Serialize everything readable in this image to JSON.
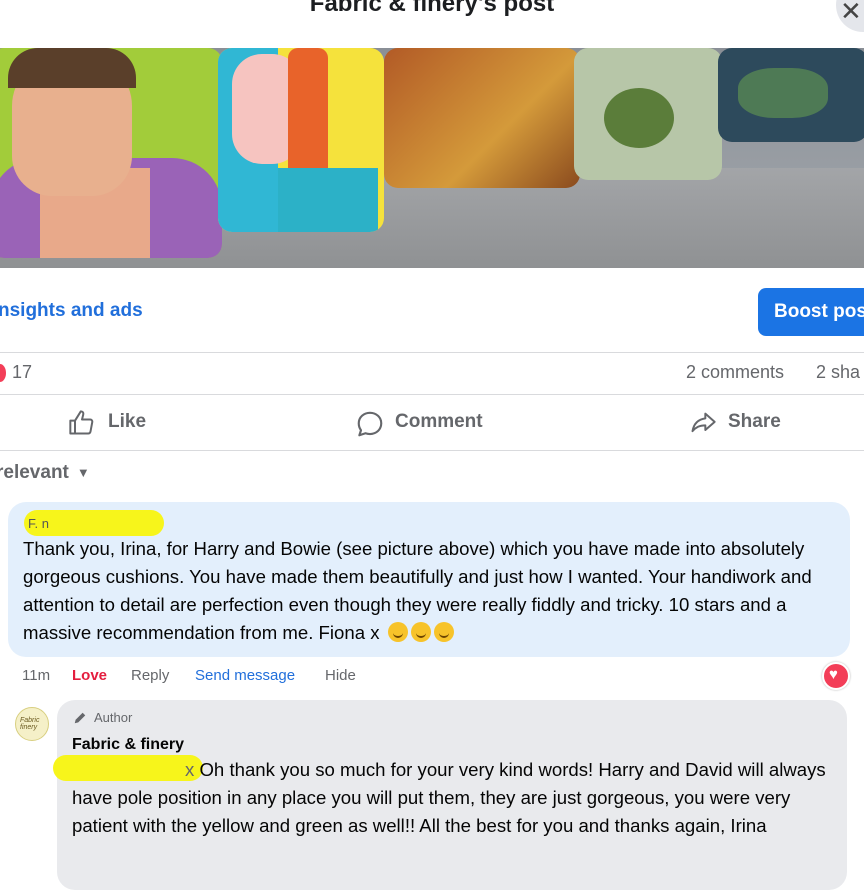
{
  "header": {
    "title": "Fabric & finery's post",
    "close_icon": "close-icon"
  },
  "photo": {
    "description_colors": [
      "#a2cc3a",
      "#f5e23c",
      "#d49a3a",
      "#b7c6a8",
      "#2d4a5c"
    ]
  },
  "insights": {
    "link_label": "nsights and ads",
    "boost_label": "Boost pos"
  },
  "reactions": {
    "count": "17",
    "comments": "2 comments",
    "shares": "2 sha"
  },
  "actions": {
    "like": "Like",
    "comment": "Comment",
    "share": "Share"
  },
  "sort": {
    "label": "relevant"
  },
  "comment1": {
    "name_fragment": "F.           n",
    "text": "Thank you, Irina, for Harry and Bowie (see picture above) which you have made into absolutely gorgeous cushions. You have made them beautifully and just how I wanted. Your handiwork and attention to detail are perfection even though they were really fiddly and tricky. 10 stars and a massive recommendation from me. Fiona x",
    "emoji_count": 3,
    "time": "11m",
    "love": "Love",
    "reply": "Reply",
    "send_message": "Send message",
    "hide": "Hide"
  },
  "comment2": {
    "badge": "Author",
    "name": "Fabric & finery",
    "avatar_text": "Fabric finery",
    "tag_fragment": "x",
    "text": "Oh thank you so much for your very kind words! Harry and David will always have pole position in any place you will put them, they are just gorgeous, you were very patient with the yellow and green as well!! All the best for you and thanks again, Irina"
  },
  "colors": {
    "accent": "#1b74e4",
    "link": "#216fdb",
    "love": "#e41e3f",
    "bubble_blue": "#e3effc",
    "bubble_gray": "#e9eaed",
    "redaction": "#f7f51b"
  }
}
